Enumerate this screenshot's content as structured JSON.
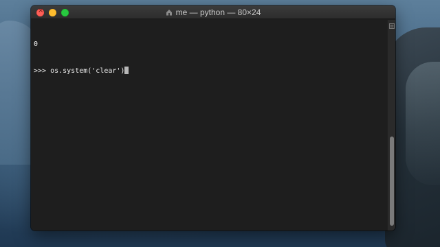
{
  "window": {
    "title": "me — python — 80×24"
  },
  "terminal": {
    "lines": [
      "0",
      ">>> os.system('clear')"
    ]
  },
  "colors": {
    "background": "#1e1e1e",
    "text": "#f1f1f1",
    "close": "#fe5f57",
    "minimize": "#febc2e",
    "maximize": "#28c840"
  },
  "icons": {
    "title": "home-icon",
    "scrollbar": "list-icon"
  }
}
